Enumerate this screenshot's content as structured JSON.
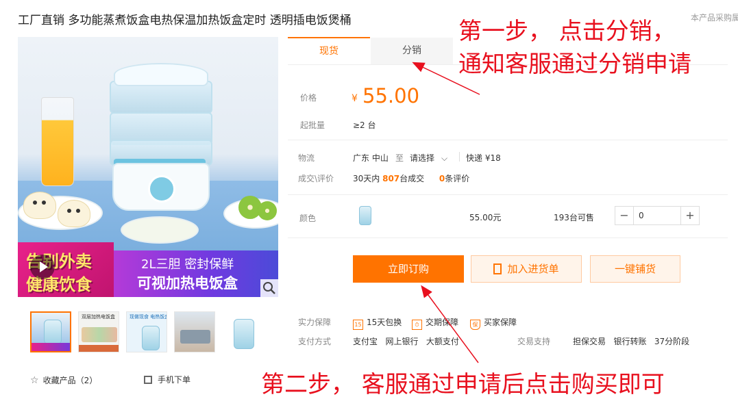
{
  "header": {
    "title": "工厂直销 多功能蒸煮饭盒电热保温加热饭盒定时 透明插电饭煲桶",
    "notice": "本产品采购属"
  },
  "gallery": {
    "promo_left_line1": "告别外卖",
    "promo_left_line2": "健康饮食",
    "promo_right_line1": "2L三胆 密封保鲜",
    "promo_right_line2": "可视加热电饭盒",
    "thumb2_caption": "双层加热电饭盒",
    "thumb3_caption": "现做现食 电热饭盒"
  },
  "actions": {
    "favorite_label": "收藏产品（2）",
    "mobile_order_label": "手机下单"
  },
  "tabs": [
    {
      "label": "现货"
    },
    {
      "label": "分销"
    }
  ],
  "price": {
    "label": "价格",
    "currency": "¥",
    "value": "55.00"
  },
  "moq": {
    "label": "起批量",
    "value": "≥2 台"
  },
  "logistics": {
    "label": "物流",
    "origin": "广东 中山",
    "to": "至",
    "destination": "请选择",
    "express": "快递 ¥18"
  },
  "deals": {
    "label": "成交\\评价",
    "prefix": "30天内",
    "count": "807",
    "suffix": "台成交",
    "reviews_count": "0",
    "reviews_suffix": "条评价"
  },
  "color_row": {
    "label": "颜色",
    "price": "55.00元",
    "stock": "193台可售",
    "quantity": "0",
    "minus": "−",
    "plus": "+"
  },
  "buttons": {
    "buy_now": "立即订购",
    "add_to_cart": "加入进货单",
    "one_click": "一键铺货"
  },
  "guarantee": {
    "label": "实力保障",
    "items": [
      "15天包换",
      "交期保障",
      "买家保障"
    ]
  },
  "payment": {
    "label": "支付方式",
    "methods": "支付宝   网上银行   大额支付",
    "trade_label": "交易支持",
    "trade_methods": "担保交易   银行转账   37分阶段"
  },
  "annotations": {
    "step1_line1": "第一步，  点击分销，",
    "step1_line2": "通知客服通过分销申请",
    "step2": "第二步，  客服通过申请后点击购买即可"
  },
  "colors": {
    "accent": "#ff7300",
    "annotation": "#e8101e"
  }
}
